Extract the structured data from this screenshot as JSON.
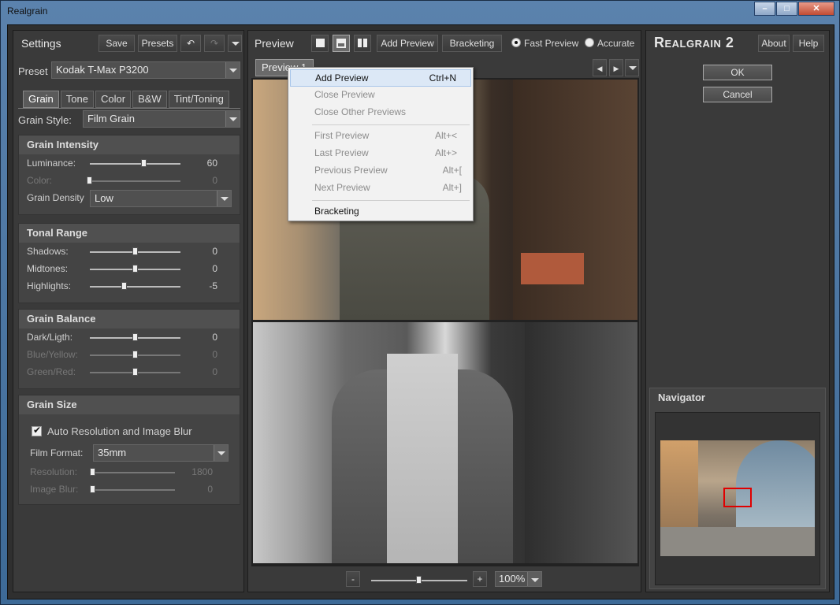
{
  "window": {
    "title": "Realgrain",
    "controls": [
      "minimize",
      "maximize",
      "close"
    ]
  },
  "settings": {
    "title": "Settings",
    "save_label": "Save",
    "presets_label": "Presets",
    "preset_label": "Preset",
    "preset_value": "Kodak T-Max P3200",
    "tabs": [
      {
        "label": "Grain",
        "active": true
      },
      {
        "label": "Tone",
        "active": false
      },
      {
        "label": "Color",
        "active": false
      },
      {
        "label": "B&W",
        "active": false
      },
      {
        "label": "Tint/Toning",
        "active": false
      }
    ],
    "grain_style_label": "Grain Style:",
    "grain_style_value": "Film Grain",
    "intensity": {
      "title": "Grain Intensity",
      "luminance": {
        "label": "Luminance:",
        "value": "60",
        "level": 0.6
      },
      "color": {
        "label": "Color:",
        "value": "0",
        "level": 0
      },
      "density_label": "Grain Density",
      "density_value": "Low"
    },
    "tonal": {
      "title": "Tonal Range",
      "shadows": {
        "label": "Shadows:",
        "value": "0",
        "level": 0.5
      },
      "midtones": {
        "label": "Midtones:",
        "value": "0",
        "level": 0.5
      },
      "highlights": {
        "label": "Highlights:",
        "value": "-5",
        "level": 0.38
      }
    },
    "balance": {
      "title": "Grain Balance",
      "dark": {
        "label": "Dark/Ligth:",
        "value": "0",
        "level": 0.5
      },
      "blue": {
        "label": "Blue/Yellow:",
        "value": "0",
        "level": 0.5
      },
      "green": {
        "label": "Green/Red:",
        "value": "0",
        "level": 0.5
      }
    },
    "size": {
      "title": "Grain Size",
      "auto_label": "Auto Resolution and Image Blur",
      "auto_checked": true,
      "film_format_label": "Film Format:",
      "film_format_value": "35mm",
      "resolution": {
        "label": "Resolution:",
        "value": "1800",
        "level": 0
      },
      "blur": {
        "label": "Image Blur:",
        "value": "0",
        "level": 0
      }
    }
  },
  "preview": {
    "title": "Preview",
    "add_preview_label": "Add Preview",
    "bracketing_label": "Bracketing",
    "fast_preview_label": "Fast Preview",
    "accurate_label": "Accurate",
    "mode": "Fast Preview",
    "tab_label": "Preview 1",
    "zoom_value": "100%",
    "zoom_minus": "-",
    "zoom_plus": "+",
    "zoom_level": 0.5
  },
  "context_menu": {
    "items": [
      {
        "label": "Add Preview",
        "shortcut": "Ctrl+N",
        "enabled": true,
        "highlighted": true
      },
      {
        "label": "Close Preview",
        "shortcut": "",
        "enabled": false
      },
      {
        "label": "Close Other Previews",
        "shortcut": "",
        "enabled": false
      },
      {
        "label": "First Preview",
        "shortcut": "Alt+<",
        "enabled": false
      },
      {
        "label": "Last Preview",
        "shortcut": "Alt+>",
        "enabled": false
      },
      {
        "label": "Previous Preview",
        "shortcut": "Alt+[",
        "enabled": false
      },
      {
        "label": "Next Preview",
        "shortcut": "Alt+]",
        "enabled": false
      },
      {
        "label": "Bracketing",
        "shortcut": "",
        "enabled": true
      }
    ]
  },
  "brand": {
    "name": "Realgrain 2",
    "about_label": "About",
    "help_label": "Help",
    "ok_label": "OK",
    "cancel_label": "Cancel"
  },
  "navigator": {
    "title": "Navigator"
  },
  "colors": {
    "panel": "#3a3a3a",
    "accent_red": "#e00000",
    "menu_highlight": "#dce8f6"
  }
}
